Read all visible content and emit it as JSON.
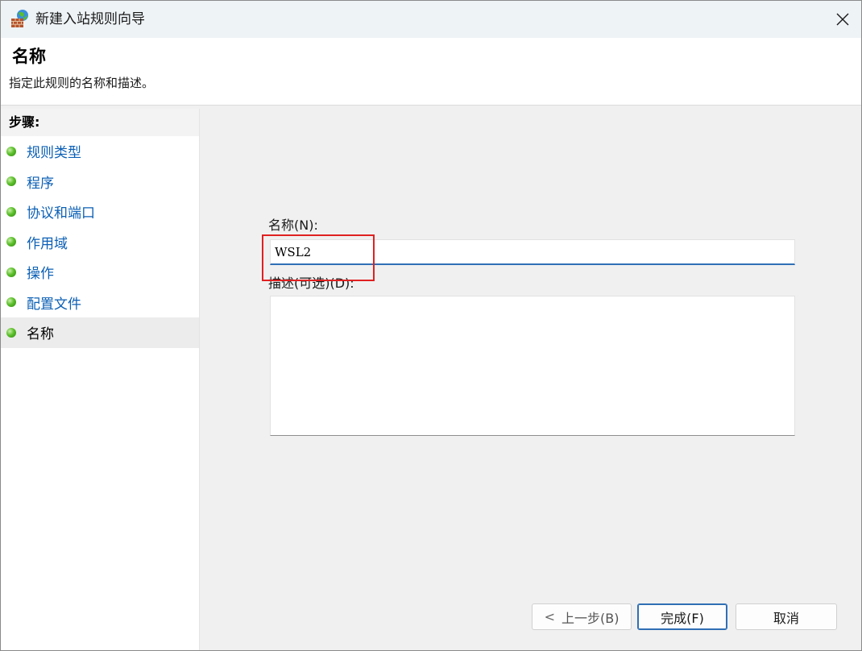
{
  "window": {
    "title": "新建入站规则向导",
    "icon": "firewall-brick-globe-icon"
  },
  "header": {
    "title": "名称",
    "subtitle": "指定此规则的名称和描述。"
  },
  "steps": {
    "heading": "步骤:",
    "items": [
      {
        "label": "规则类型",
        "current": false
      },
      {
        "label": "程序",
        "current": false
      },
      {
        "label": "协议和端口",
        "current": false
      },
      {
        "label": "作用域",
        "current": false
      },
      {
        "label": "操作",
        "current": false
      },
      {
        "label": "配置文件",
        "current": false
      },
      {
        "label": "名称",
        "current": true
      }
    ]
  },
  "form": {
    "name_label": "名称(N):",
    "name_value": "WSL2",
    "description_label": "描述(可选)(D):",
    "description_value": ""
  },
  "buttons": {
    "back": "上一步(B)",
    "back_chevron": "<",
    "finish": "完成(F)",
    "cancel": "取消"
  },
  "colors": {
    "link": "#0b5fb5",
    "highlight": "#e02020",
    "accent": "#2f6fb5"
  }
}
